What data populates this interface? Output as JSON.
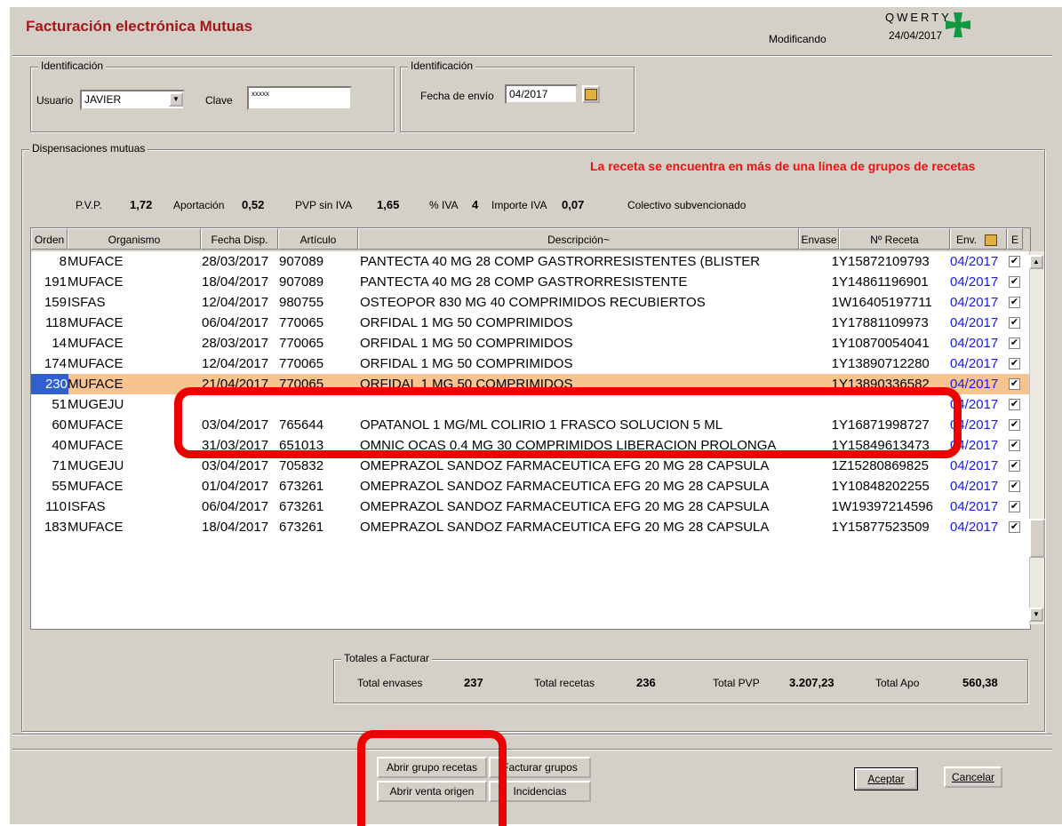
{
  "window": {
    "title": "Facturación electrónica Mutuas",
    "mode": "Modificando",
    "brand": "QWERTY",
    "date": "24/04/2017"
  },
  "identificacion_usuario": {
    "group_title": "Identificación",
    "usuario_label": "Usuario",
    "usuario_value": "JAVIER",
    "clave_label": "Clave",
    "clave_value": "xxxxx"
  },
  "identificacion_envio": {
    "group_title": "Identificación",
    "fecha_label": "Fecha de envío",
    "fecha_value": "04/2017"
  },
  "dispensaciones": {
    "group_title": "Dispensaciones mutuas",
    "warning": "La receta se encuentra en más de una línea de grupos de recetas",
    "stats": {
      "pvp_label": "P.V.P.",
      "pvp_value": "1,72",
      "aport_label": "Aportación",
      "aport_value": "0,52",
      "sin_iva_label": "PVP sin IVA",
      "sin_iva_value": "1,65",
      "iva_label": "% IVA",
      "iva_value": "4",
      "imp_iva_label": "Importe IVA",
      "imp_iva_value": "0,07",
      "colectivo": "Colectivo subvencionado"
    },
    "columns": [
      "Orden",
      "Organismo",
      "Fecha Disp.",
      "Artículo",
      "Descripción~",
      "Envase",
      "Nº Receta",
      "Env.",
      "E"
    ],
    "rows": [
      {
        "orden": "8",
        "org": "MUFACE",
        "fecha": "28/03/2017",
        "art": "907089",
        "desc": "PANTECTA 40 MG 28 COMP GASTRORRESISTENTES (BLISTER",
        "env": "1",
        "receta": "Y15872109793",
        "renv": "04/2017",
        "check": "✔"
      },
      {
        "orden": "191",
        "org": "MUFACE",
        "fecha": "18/04/2017",
        "art": "907089",
        "desc": "PANTECTA 40 MG 28 COMP GASTRORRESISTENTE",
        "env": "1",
        "receta": "Y14861196901",
        "renv": "04/2017",
        "check": "✔"
      },
      {
        "orden": "159",
        "org": "ISFAS",
        "fecha": "12/04/2017",
        "art": "980755",
        "desc": "OSTEOPOR 830 MG 40 COMPRIMIDOS RECUBIERTOS",
        "env": "1",
        "receta": "W16405197711",
        "renv": "04/2017",
        "check": "✔"
      },
      {
        "orden": "118",
        "org": "MUFACE",
        "fecha": "06/04/2017",
        "art": "770065",
        "desc": "ORFIDAL 1 MG 50 COMPRIMIDOS",
        "env": "1",
        "receta": "Y17881109973",
        "renv": "04/2017",
        "check": "✔"
      },
      {
        "orden": "14",
        "org": "MUFACE",
        "fecha": "28/03/2017",
        "art": "770065",
        "desc": "ORFIDAL 1 MG 50 COMPRIMIDOS",
        "env": "1",
        "receta": "Y10870054041",
        "renv": "04/2017",
        "check": "✔"
      },
      {
        "orden": "174",
        "org": "MUFACE",
        "fecha": "12/04/2017",
        "art": "770065",
        "desc": "ORFIDAL 1 MG 50 COMPRIMIDOS",
        "env": "1",
        "receta": "Y13890712280",
        "renv": "04/2017",
        "check": "✔"
      },
      {
        "orden": "230",
        "org": "MUFACE",
        "fecha": "21/04/2017",
        "art": "770065",
        "desc": "ORFIDAL 1 MG 50 COMPRIMIDOS",
        "env": "1",
        "receta": "Y13890336582",
        "renv": "04/2017",
        "check": "✔"
      },
      {
        "orden": "51",
        "org": "MUGEJU",
        "fecha": "",
        "art": "",
        "desc": "",
        "env": "",
        "receta": "",
        "renv": "04/2017",
        "check": "✔"
      },
      {
        "orden": "60",
        "org": "MUFACE",
        "fecha": "03/04/2017",
        "art": "765644",
        "desc": "OPATANOL 1 MG/ML COLIRIO 1 FRASCO SOLUCION 5 ML",
        "env": "1",
        "receta": "Y16871998727",
        "renv": "04/2017",
        "check": "✔"
      },
      {
        "orden": "40",
        "org": "MUFACE",
        "fecha": "31/03/2017",
        "art": "651013",
        "desc": "OMNIC OCAS 0.4 MG 30 COMPRIMIDOS LIBERACION PROLONGA",
        "env": "1",
        "receta": "Y15849613473",
        "renv": "04/2017",
        "check": "✔"
      },
      {
        "orden": "71",
        "org": "MUGEJU",
        "fecha": "03/04/2017",
        "art": "705832",
        "desc": "OMEPRAZOL SANDOZ FARMACEUTICA EFG 20 MG 28 CAPSULA",
        "env": "1",
        "receta": "Z15280869825",
        "renv": "04/2017",
        "check": "✔"
      },
      {
        "orden": "55",
        "org": "MUFACE",
        "fecha": "01/04/2017",
        "art": "673261",
        "desc": "OMEPRAZOL SANDOZ FARMACEUTICA EFG 20 MG 28 CAPSULA",
        "env": "1",
        "receta": "Y10848202255",
        "renv": "04/2017",
        "check": "✔"
      },
      {
        "orden": "110",
        "org": "ISFAS",
        "fecha": "06/04/2017",
        "art": "673261",
        "desc": "OMEPRAZOL SANDOZ FARMACEUTICA EFG 20 MG 28 CAPSULA",
        "env": "1",
        "receta": "W19397214596",
        "renv": "04/2017",
        "check": "✔"
      },
      {
        "orden": "183",
        "org": "MUFACE",
        "fecha": "18/04/2017",
        "art": "673261",
        "desc": "OMEPRAZOL SANDOZ FARMACEUTICA EFG 20 MG 28 CAPSULA",
        "env": "1",
        "receta": "Y15877523509",
        "renv": "04/2017",
        "check": "✔"
      }
    ],
    "selected_index": 6
  },
  "totales": {
    "group_title": "Totales a Facturar",
    "envases_label": "Total envases",
    "envases_value": "237",
    "recetas_label": "Total recetas",
    "recetas_value": "236",
    "pvp_label": "Total PVP",
    "pvp_value": "3.207,23",
    "apo_label": "Total Apo",
    "apo_value": "560,38"
  },
  "buttons": {
    "abrir_grupo": "Abrir grupo recetas",
    "facturar": "Facturar grupos",
    "abrir_venta": "Abrir venta origen",
    "incidencias": "Incidencias",
    "aceptar": "Aceptar",
    "cancelar": "Cancelar"
  },
  "colors": {
    "title": "#a01818",
    "warning": "#ee1111",
    "selected_row": "#f7c38f",
    "annotation": "#ee0000",
    "env_text": "#1a1ae0"
  }
}
